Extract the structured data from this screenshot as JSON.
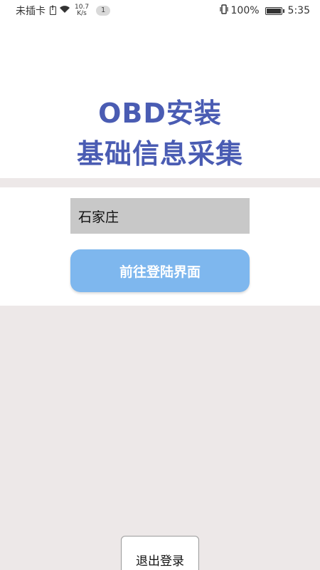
{
  "status_bar": {
    "carrier": "未插卡",
    "net_speed_value": "10.7",
    "net_speed_unit": "K/s",
    "notification_count": "1",
    "battery": "100%",
    "time": "5:35"
  },
  "header": {
    "title_line1": "OBD安装",
    "title_line2": "基础信息采集"
  },
  "form": {
    "city_value": "石家庄",
    "login_button": "前往登陆界面"
  },
  "footer": {
    "logout_button": "退出登录"
  },
  "colors": {
    "title": "#4a5cb3",
    "button": "#7eb7ee",
    "input_bg": "#c8c8c8",
    "page_bg": "#ede8e8"
  },
  "icons": {
    "sim": "sim-missing-icon",
    "wifi": "wifi-icon",
    "vibrate": "vibrate-icon",
    "battery": "battery-icon"
  }
}
